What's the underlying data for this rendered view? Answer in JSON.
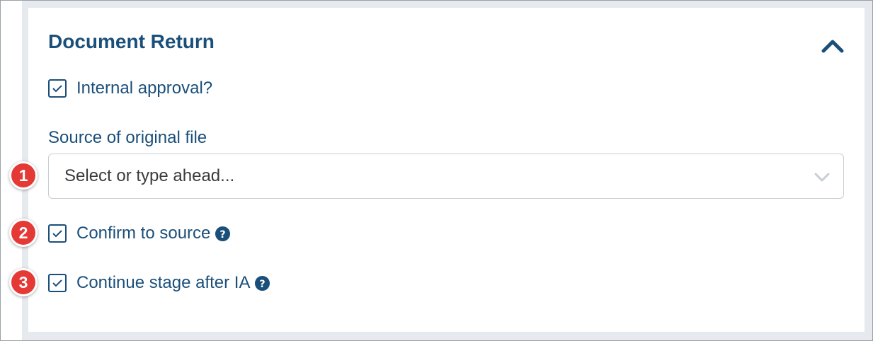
{
  "panel": {
    "title": "Document Return",
    "collapse_icon": "chevron-up-icon"
  },
  "colors": {
    "accent": "#1a4f7a",
    "badge": "#e53935",
    "panel_bg": "#e6e9ee"
  },
  "internal_approval": {
    "label": "Internal approval?",
    "checked": true
  },
  "source": {
    "label": "Source of original file",
    "placeholder": "Select or type ahead...",
    "dropdown_icon": "chevron-down-icon"
  },
  "confirm": {
    "label": "Confirm to source",
    "checked": true,
    "help_icon": "question-circle-icon"
  },
  "continue_stage": {
    "label": "Continue stage after IA",
    "checked": true,
    "help_icon": "question-circle-icon"
  },
  "callouts": [
    "1",
    "2",
    "3"
  ]
}
